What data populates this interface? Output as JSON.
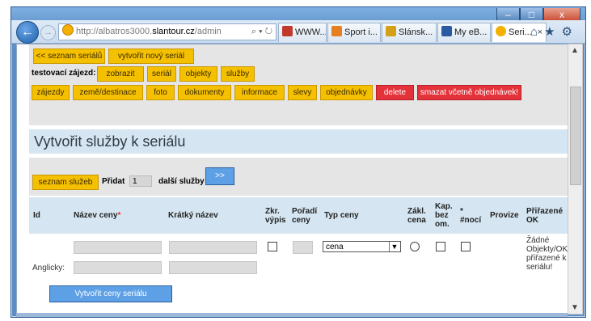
{
  "browser": {
    "url_prefix": "http://albatros3000.",
    "url_host": "slantour.cz",
    "url_suffix": "/admin",
    "address_controls": "⌕ ▾ ↻",
    "tabs": [
      {
        "label": "WWW...",
        "icon_color": "#c0392b"
      },
      {
        "label": "Sport i...",
        "icon_color": "#e67e22"
      },
      {
        "label": "Slánsk...",
        "icon_color": "#d4a017"
      },
      {
        "label": "My eB...",
        "icon_color": "#2c5aa0"
      },
      {
        "label": "Seri...",
        "icon_color": "#f2b100"
      }
    ],
    "tab_close": "×",
    "nav_icons": "⌂★⚙",
    "win_minimize": "–",
    "win_maximize": "□",
    "win_close": "x"
  },
  "toolbar": {
    "row1": [
      "<< seznam seriálů",
      "vytvořit nový seriál"
    ],
    "tour_label": "testovací zájezd:",
    "row2": [
      "zobrazit",
      "seriál",
      "objekty",
      "služby"
    ],
    "row3": [
      "zájezdy",
      "země/destinace",
      "foto",
      "dokumenty",
      "informace",
      "slevy",
      "objednávky"
    ],
    "delete_label": "delete",
    "delete_all_label": "smazat včetně objednávek!"
  },
  "page": {
    "heading": "Vytvořit služby k seriálu",
    "service_list_btn": "seznam služeb",
    "add_label": "Přidat",
    "add_count": "1",
    "more_label": "další služby",
    "go_btn": ">>"
  },
  "table": {
    "headers": {
      "id": "Id",
      "name": "Název ceny",
      "required_mark": "*",
      "short": "Krátký název",
      "zkr_vypis_1": "Zkr.",
      "zkr_vypis_2": "výpis",
      "poradi_1": "Pořadí",
      "poradi_2": "ceny",
      "type": "Typ ceny",
      "zakl_1": "Zákl.",
      "zakl_2": "cena",
      "kap_1": "Kap.",
      "kap_2": "bez",
      "kap_3": "om.",
      "noci_1": "*",
      "noci_2": "#nocí",
      "provize": "Provize",
      "prirazene_1": "Přiřazené",
      "prirazene_2": "OK"
    },
    "row": {
      "type_value": "cena",
      "assigned_lines": [
        "Žádné",
        "Objekty/OK",
        "přiřazené k",
        "seriálu!"
      ]
    },
    "english_label": "Anglicky:"
  },
  "submit_label": "Vytvořit ceny seriálu",
  "colors": {
    "yellow_btn": "#f5c000",
    "red_btn": "#e3323a",
    "blue_btn": "#5da0e6",
    "header_bg": "#d5e6f2",
    "panel_bg": "#e5e5e5"
  }
}
